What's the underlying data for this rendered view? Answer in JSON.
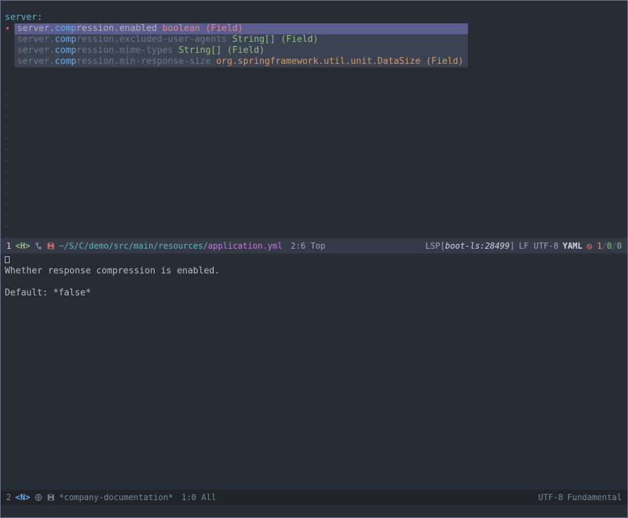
{
  "code": {
    "key": "server",
    "colon": ":",
    "typed": "comp"
  },
  "tilde": "~",
  "popup": {
    "items": [
      {
        "prefix": "server.",
        "match": "comp",
        "rest": "ression.enabled",
        "type": "boolean (Field)",
        "type_class": "p-type1",
        "selected": true
      },
      {
        "prefix": "server.",
        "match": "comp",
        "rest": "ression.excluded-user-agents",
        "type": "String[] (Field)",
        "type_class": "p-type2",
        "selected": false
      },
      {
        "prefix": "server.",
        "match": "comp",
        "rest": "ression.mime-types",
        "type": "String[] (Field)",
        "type_class": "p-type2",
        "selected": false
      },
      {
        "prefix": "server.",
        "match": "comp",
        "rest": "ression.min-response-size",
        "type": "org.springframework.util.unit.DataSize (Field)",
        "type_class": "p-type3",
        "selected": false
      }
    ]
  },
  "modeline_top": {
    "num": "1",
    "state": "<H>",
    "path_muted": "~/S/C/demo/src/main/resources/",
    "path_file": "application.yml",
    "pos": "2:6 Top",
    "lsp_label": "LSP[",
    "lsp_server": "boot-ls",
    "lsp_port": ":28499",
    "lsp_close": "]",
    "encoding": "LF UTF-8",
    "mode": "YAML",
    "lint": {
      "err": "1",
      "warn": "0",
      "info": "0"
    }
  },
  "doc": {
    "line1": "Whether response compression is enabled.",
    "line2": "Default: *false*"
  },
  "modeline_bottom": {
    "num": "2",
    "state": "<N>",
    "buffer": "*company-documentation*",
    "pos": "1:0 All",
    "encoding": "UTF-8",
    "mode": "Fundamental"
  }
}
